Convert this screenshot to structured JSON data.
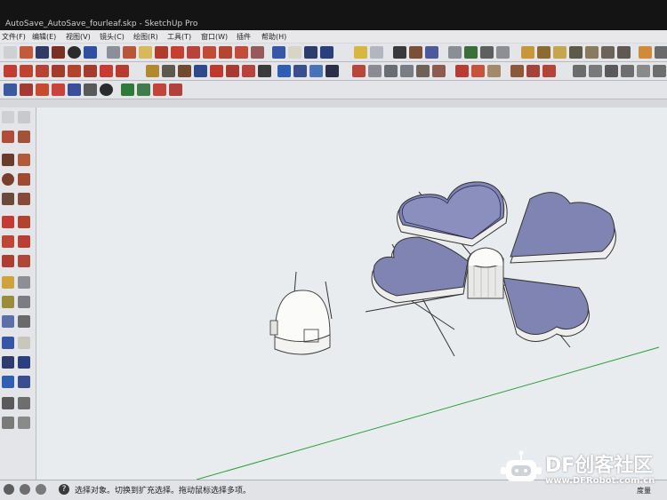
{
  "window": {
    "title": "AutoSave_AutoSave_fourleaf.skp - SketchUp Pro"
  },
  "menu": {
    "items": [
      "文件(F)",
      "编辑(E)",
      "视图(V)",
      "镜头(C)",
      "绘图(R)",
      "工具(T)",
      "窗口(W)",
      "插件",
      "帮助(H)"
    ]
  },
  "status": {
    "hint": "选择对象。切换到扩充选择。拖动鼠标选择多项。",
    "measure_label": "度量"
  },
  "watermark": {
    "brand": "DF创客社区",
    "url": "www.DFRobot.com.cn"
  },
  "colors": {
    "petal_fill": "#7f84b3",
    "petal_side": "#eeeeec",
    "viewport_bg": "#e9ecef",
    "axis_green": "#2e9c3a"
  },
  "icons": {
    "toolbar_rows": [
      "select",
      "eraser",
      "paint",
      "circle",
      "arc",
      "push-pull",
      "move",
      "rotate",
      "orbit",
      "zoom",
      "camera",
      "section",
      "sandbox",
      "shadow",
      "components"
    ]
  }
}
